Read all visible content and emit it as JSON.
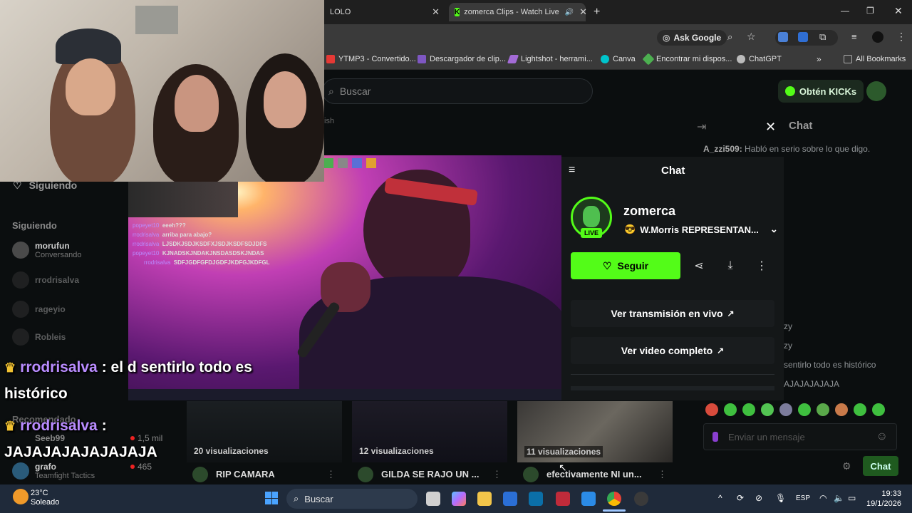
{
  "tabs": [
    {
      "label": "LOLO",
      "active": false
    },
    {
      "label": "zomerca Clips - Watch Live",
      "active": true
    }
  ],
  "toolbar": {
    "ask_google": "Ask Google"
  },
  "bookmarks": [
    {
      "label": "YTMP3 - Convertido...",
      "color": "#e53935"
    },
    {
      "label": "Descargador de clip...",
      "color": "#7e57c2"
    },
    {
      "label": "Lightshot - herrami...",
      "color": "#a36bd6"
    },
    {
      "label": "Canva",
      "color": "#00c4cc"
    },
    {
      "label": "Encontrar mi dispos...",
      "color": "#4caf50"
    },
    {
      "label": "ChatGPT",
      "color": "#bbbbbb"
    },
    {
      "label": "All Bookmarks",
      "color": "#888888"
    }
  ],
  "site": {
    "search_placeholder": "Buscar",
    "kicks_button": "Obtén KICKs",
    "hidden_label": "ish",
    "chat_header": "Chat",
    "right_chat_first": {
      "user": "A_zzi509:",
      "text": "Habló en serio sobre lo que digo."
    },
    "right_chat_lines": [
      "zy",
      "zy",
      "sentirlo todo es histórico",
      "AJAJAJAJAJA"
    ],
    "message_placeholder": "Enviar un mensaje",
    "chat_button": "Chat"
  },
  "sidebar": {
    "following_top": "Siguiendo",
    "following_label": "Siguiendo",
    "items": [
      {
        "name": "morufun",
        "sub": "Conversando"
      },
      {
        "name": "rrodrisalva",
        "sub": ""
      },
      {
        "name": "rageyio",
        "sub": ""
      },
      {
        "name": "Robleis",
        "sub": ""
      }
    ],
    "recommended_label": "Recomendado",
    "recommended": [
      {
        "name": "Seeb99",
        "viewers": "1,5 mil",
        "sub": ""
      },
      {
        "name": "grafo",
        "viewers": "465",
        "sub": "Teamfight Tactics"
      }
    ]
  },
  "video_chat": [
    {
      "user": "popeyet10",
      "text": "eeeh???"
    },
    {
      "user": "rrodrisalva",
      "text": "arriba para abajo?"
    },
    {
      "user": "rrodrisalva",
      "text": "LJSDKJSDJKSDFXJSDJKSDFSDJDFS"
    },
    {
      "user": "popeyet10",
      "text": "KJNADSKJNDAKJNSDASDSKJNDAS"
    },
    {
      "user": "rrodrisalva",
      "text": "SDFJGDFGFDJGDFJKDFGJKDFGL"
    }
  ],
  "panel": {
    "title": "Chat",
    "channel": "zomerca",
    "live_badge": "LIVE",
    "stream_title": "W.Morris REPRESENTAN...",
    "follow_label": "Seguir",
    "watch_live": "Ver transmisión en vivo",
    "watch_full": "Ver video completo"
  },
  "big_chat": [
    {
      "user": "rrodrisalva",
      "line1": ": el d sentirlo todo es",
      "line2": "histórico"
    },
    {
      "user": "rrodrisalva",
      "line1": ":",
      "line2": "JAJAJAJAJAJAJAJA"
    }
  ],
  "thumbnails": [
    {
      "views": "20 visualizaciones",
      "title": "RIP CAMARA"
    },
    {
      "views": "12 visualizaciones",
      "title": "GILDA SE RAJO UN ..."
    },
    {
      "views": "11 visualizaciones",
      "title": "efectivamente NI un..."
    }
  ],
  "taskbar": {
    "weather_temp": "23°C",
    "weather_desc": "Soleado",
    "search": "Buscar",
    "lang": "ESP",
    "time": "19:33",
    "date": "19/1/2026"
  },
  "colors": {
    "kick_green": "#53fc18",
    "chat_name": "#b98cff"
  }
}
